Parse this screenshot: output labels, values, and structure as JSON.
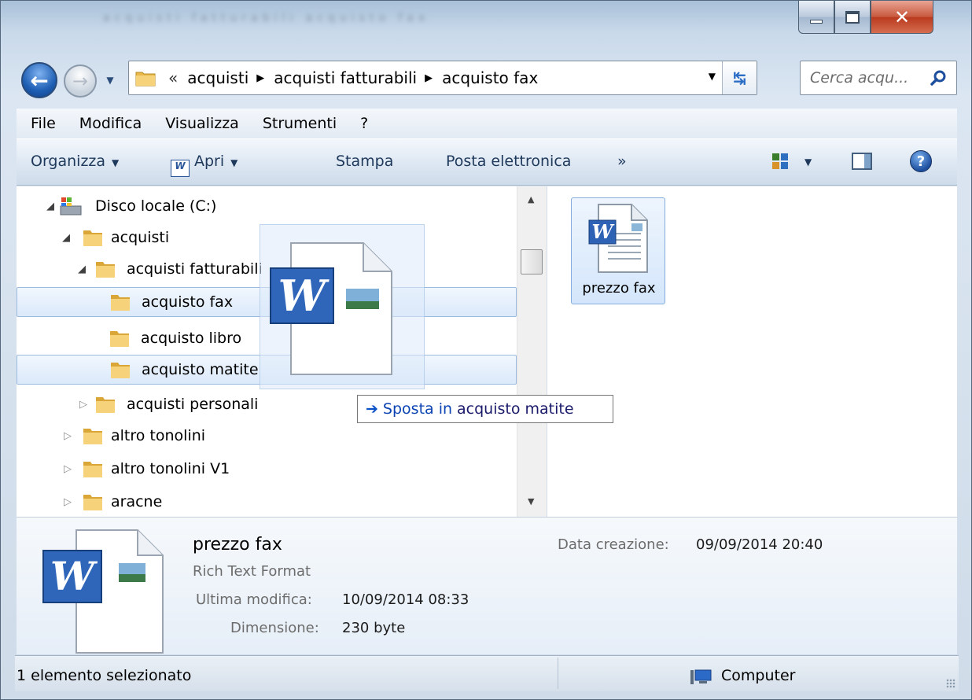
{
  "window": {
    "blurred_title": "acquisti fatturabili acquisto fax"
  },
  "address": {
    "overflow": "«",
    "crumbs": [
      "acquisti",
      "acquisti fatturabili",
      "acquisto fax"
    ]
  },
  "search": {
    "placeholder": "Cerca acqu..."
  },
  "menu": [
    "File",
    "Modifica",
    "Visualizza",
    "Strumenti",
    "?"
  ],
  "toolbar": {
    "organize": "Organizza",
    "open": "Apri",
    "open_icon_letter": "W",
    "print": "Stampa",
    "email": "Posta elettronica",
    "more": "»"
  },
  "tree": [
    {
      "label": "Disco locale (C:)",
      "type": "drive",
      "expanded": true
    },
    {
      "label": "acquisti",
      "type": "folder",
      "expanded": true
    },
    {
      "label": "acquisti fatturabili",
      "type": "folder",
      "expanded": true
    },
    {
      "label": "acquisto fax",
      "type": "folder",
      "selected": true
    },
    {
      "label": "acquisto libro",
      "type": "folder"
    },
    {
      "label": "acquisto matite",
      "type": "folder",
      "drop_target": true
    },
    {
      "label": "acquisti personali",
      "type": "folder",
      "expanded": false
    },
    {
      "label": "altro tonolini",
      "type": "folder",
      "expanded": false
    },
    {
      "label": "altro tonolini V1",
      "type": "folder",
      "expanded": false
    },
    {
      "label": "aracne",
      "type": "folder",
      "expanded": false
    }
  ],
  "file": {
    "name": "prezzo fax",
    "type": "Rich Text Format",
    "modified_label": "Ultima modifica:",
    "modified_value": "10/09/2014 08:33",
    "size_label": "Dimensione:",
    "size_value": "230 byte",
    "created_label": "Data creazione:",
    "created_value": "09/09/2014 20:40"
  },
  "drag": {
    "verb": "Sposta in",
    "target": "acquisto matite"
  },
  "status": {
    "selection": "1 elemento selezionato",
    "location": "Computer"
  },
  "colors": {
    "accent": "#1f5fb4",
    "selection_border": "#9dbbe0",
    "folder": "#e8b94a"
  }
}
